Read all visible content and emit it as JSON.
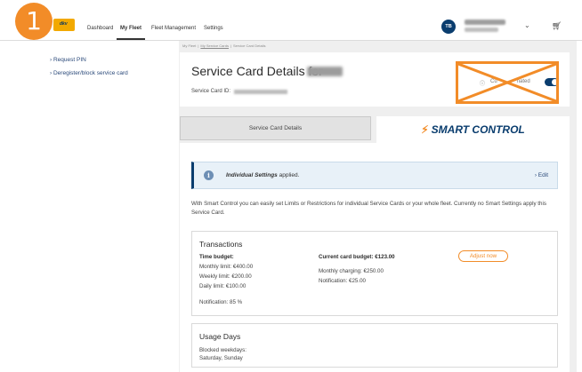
{
  "step_badge": "1",
  "nav": {
    "items": [
      {
        "label": "Dashboard",
        "active": false
      },
      {
        "label": "My Fleet",
        "active": true
      },
      {
        "label": "Fleet Management",
        "active": false
      },
      {
        "label": "Settings",
        "active": false
      }
    ],
    "avatar_initials": "TB"
  },
  "sidebar": {
    "links": [
      "Request PIN",
      "Deregister/block service card"
    ]
  },
  "breadcrumb": [
    "My Fleet",
    "My Service Cards",
    "Service Card Details"
  ],
  "header": {
    "title": "Service Card Details for",
    "card_id_label": "Service Card ID:"
  },
  "toggle_area": {
    "label_visible": "Cu",
    "label_tail": "nated"
  },
  "tabs": {
    "details": "Service Card Details",
    "smart": "SMART CONTROL"
  },
  "alert": {
    "bold": "Individual Settings",
    "rest": "applied.",
    "edit": "Edit"
  },
  "intro": "With Smart Control you can easily set Limits or Restrictions for individual Service Cards or your whole fleet. Currently no Smart Settings apply this Service Card.",
  "transactions": {
    "title": "Transactions",
    "time_budget_label": "Time budget:",
    "monthly_limit": "Monthly limit: €400.00",
    "weekly_limit": "Weekly limit: €200.00",
    "daily_limit": "Daily limit: €100.00",
    "notification_pct": "Notification: 85 %",
    "current_budget": "Current card budget: €123.00",
    "monthly_charging": "Monthly charging: €250.00",
    "notification_amt": "Notification: €25.00",
    "adjust_button": "Adjust now"
  },
  "usage_days": {
    "title": "Usage Days",
    "blocked_label": "Blocked weekdays:",
    "blocked_days": "Saturday, Sunday"
  },
  "colors": {
    "accent": "#f28c28",
    "brand_blue": "#0a3d6e",
    "logo_yellow": "#f2a900"
  }
}
